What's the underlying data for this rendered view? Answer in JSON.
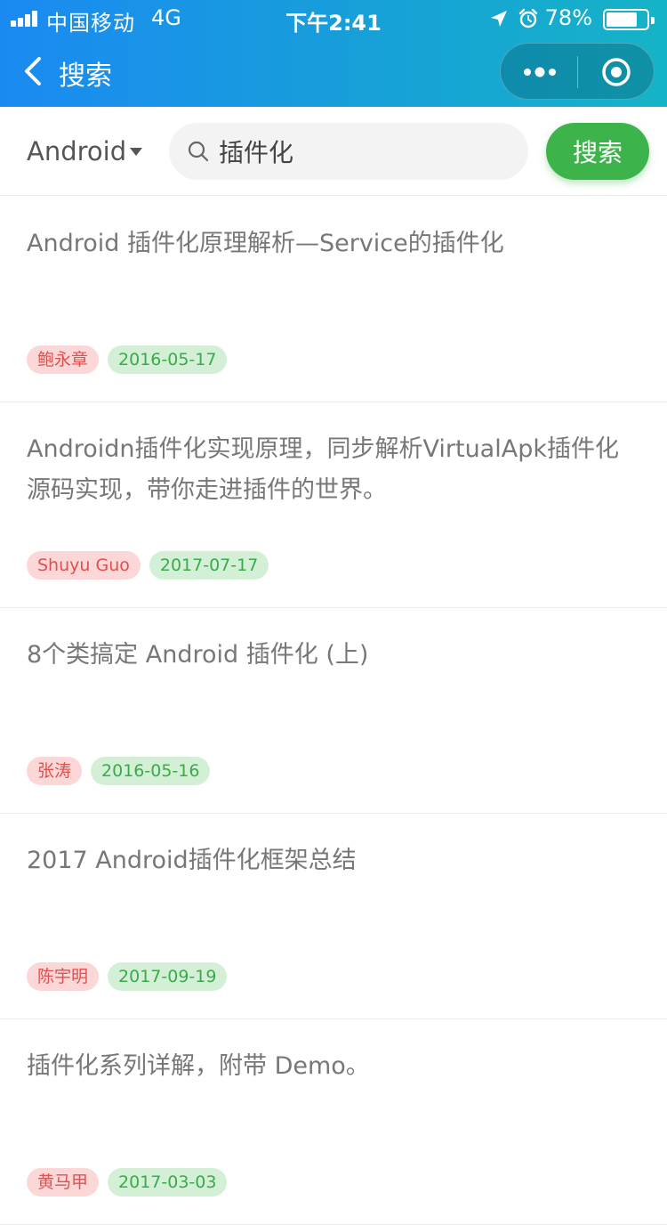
{
  "status_bar": {
    "carrier": "中国移动",
    "network": "4G",
    "time": "下午2:41",
    "battery_percent": "78%",
    "battery_level": 0.78,
    "icons": [
      "signal-icon",
      "location-arrow-icon",
      "alarm-clock-icon",
      "battery-icon"
    ]
  },
  "nav": {
    "title": "搜索",
    "back_icon": "chevron-left-icon",
    "more_icon": "more-dots-icon",
    "close_icon": "target-circle-icon"
  },
  "search": {
    "category": "Android",
    "query": "插件化",
    "button_label": "搜索",
    "icon": "search-icon"
  },
  "results": [
    {
      "title": "Android 插件化原理解析—Service的插件化",
      "author": "鲍永章",
      "date": "2016-05-17"
    },
    {
      "title": "Androidn插件化实现原理，同步解析VirtualApk插件化源码实现，带你走进插件的世界。",
      "author": "Shuyu Guo",
      "date": "2017-07-17"
    },
    {
      "title": "8个类搞定 Android 插件化 (上)",
      "author": "张涛",
      "date": "2016-05-16"
    },
    {
      "title": "2017 Android插件化框架总结",
      "author": "陈宇明",
      "date": "2017-09-19"
    },
    {
      "title": "插件化系列详解，附带 Demo。",
      "author": "黄马甲",
      "date": "2017-03-03"
    }
  ],
  "colors": {
    "header_gradient_start": "#1a8af2",
    "header_gradient_end": "#15b3c7",
    "search_button": "#3cb44b",
    "author_tag_bg": "#fcd7d7",
    "author_tag_text": "#e05050",
    "date_tag_bg": "#d3f0d6",
    "date_tag_text": "#3aaa4a"
  }
}
